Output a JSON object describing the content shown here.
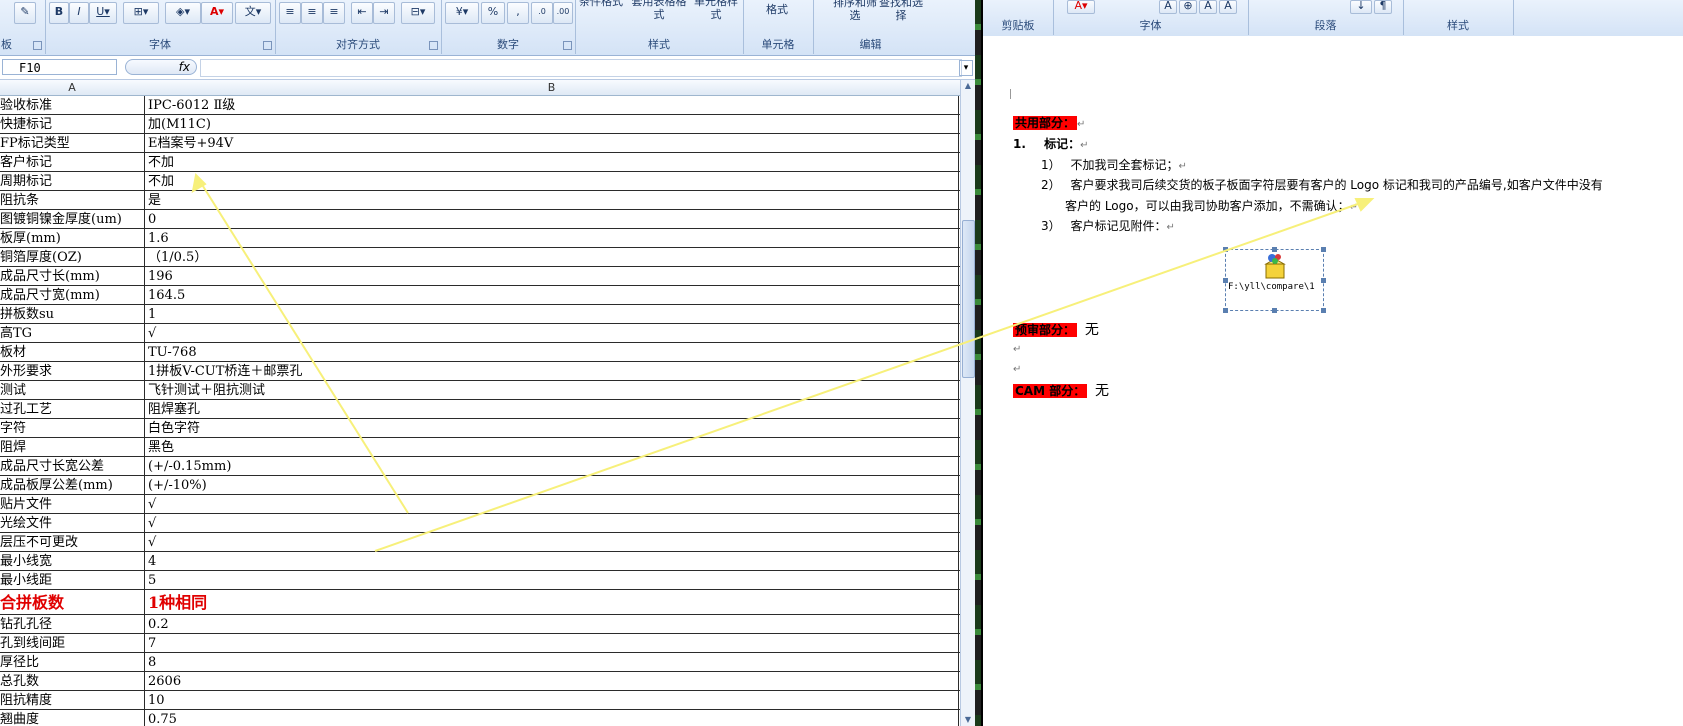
{
  "excel": {
    "ribbon_groups": [
      "字体",
      "对齐方式",
      "数字",
      "样式",
      "单元格",
      "编辑"
    ],
    "ribbon_left_cut": "板",
    "style_buttons": [
      "条件格式",
      "套用表格格式",
      "单元格样式"
    ],
    "cell_button": "格式",
    "edit_buttons": [
      "排序和筛选",
      "查找和选择"
    ],
    "name_box": "F10",
    "fx_label": "fx",
    "col_a": "A",
    "col_b": "B",
    "rows": [
      {
        "a": "验收标准",
        "b": "IPC-6012 Ⅱ级"
      },
      {
        "a": "快捷标记",
        "b": "加(M11C)"
      },
      {
        "a": "FP标记类型",
        "b": "E档案号+94V"
      },
      {
        "a": "客户标记",
        "b": "不加"
      },
      {
        "a": "周期标记",
        "b": "不加"
      },
      {
        "a": "阻抗条",
        "b": "是"
      },
      {
        "a": "图镀铜镍金厚度(um)",
        "b": "0"
      },
      {
        "a": "板厚(mm)",
        "b": "1.6"
      },
      {
        "a": "铜箔厚度(OZ)",
        "b": "（1/0.5）"
      },
      {
        "a": "成品尺寸长(mm)",
        "b": "196"
      },
      {
        "a": "成品尺寸宽(mm)",
        "b": "164.5"
      },
      {
        "a": "拼板数su",
        "b": "1"
      },
      {
        "a": "高TG",
        "b": "√"
      },
      {
        "a": "板材",
        "b": "TU-768"
      },
      {
        "a": "外形要求",
        "b": "1拼板V-CUT桥连＋邮票孔"
      },
      {
        "a": "测试",
        "b": "飞针测试＋阻抗测试"
      },
      {
        "a": "过孔工艺",
        "b": "阻焊塞孔"
      },
      {
        "a": "字符",
        "b": "白色字符"
      },
      {
        "a": "阻焊",
        "b": "黑色"
      },
      {
        "a": "成品尺寸长宽公差",
        "b": "(+/-0.15mm)"
      },
      {
        "a": "成品板厚公差(mm)",
        "b": "(+/-10%)"
      },
      {
        "a": "贴片文件",
        "b": "√"
      },
      {
        "a": "光绘文件",
        "b": "√"
      },
      {
        "a": "层压不可更改",
        "b": "√"
      },
      {
        "a": "最小线宽",
        "b": "4"
      },
      {
        "a": "最小线距",
        "b": "5"
      },
      {
        "a": "合拼板数",
        "b": "1种相同",
        "emphasis": true
      },
      {
        "a": "钻孔孔径",
        "b": "0.2"
      },
      {
        "a": "孔到线间距",
        "b": "7"
      },
      {
        "a": "厚径比",
        "b": "8"
      },
      {
        "a": "总孔数",
        "b": "2606"
      },
      {
        "a": "阻抗精度",
        "b": "10"
      },
      {
        "a": "翘曲度",
        "b": "0.75"
      }
    ]
  },
  "word": {
    "ribbon_groups": [
      "剪贴板",
      "字体",
      "段落",
      "样式"
    ],
    "section_common": "共用部分：",
    "item1_num": "1.",
    "item1_title": "标记：",
    "sub1_num": "1）",
    "sub1_text": "不加我司全套标记；",
    "sub2_num": "2）",
    "sub2_line1": "客户要求我司后续交货的板子板面字符层要有客户的 Logo 标记和我司的产品编号,如客户文件中没有",
    "sub2_line2": "客户的 Logo，可以由我司协助客户添加，不需确认；",
    "sub3_num": "3）",
    "sub3_text": "客户标记见附件：",
    "attachment_name": "F:\\yll\\compare\\1",
    "section_preaudit": "预审部分：",
    "preaudit_value": "无",
    "section_cam": "CAM 部分：",
    "cam_value": "无",
    "return_mark": "↵"
  }
}
